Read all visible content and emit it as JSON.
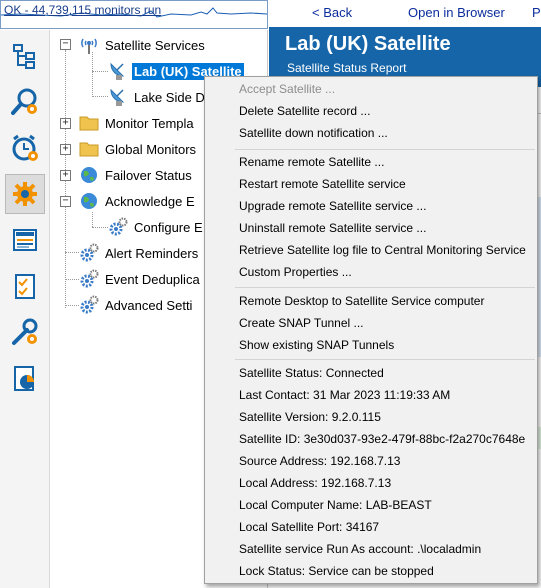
{
  "status_strip": {
    "text": "OK - 44,739,115 monitors run"
  },
  "icon_bar": {
    "items": [
      {
        "icon": "tree-structure-icon"
      },
      {
        "icon": "search-settings-icon"
      },
      {
        "icon": "alarm-clock-icon"
      },
      {
        "icon": "gear-settings-icon"
      },
      {
        "icon": "news-icon"
      },
      {
        "icon": "checklist-icon"
      },
      {
        "icon": "tools-icon"
      },
      {
        "icon": "report-chart-icon"
      }
    ]
  },
  "tree": {
    "satellite_services": "Satellite Services",
    "lab_uk": "Lab (UK) Satellite",
    "lake_side": "Lake Side D",
    "monitor_templates": "Monitor Templa",
    "global_monitors": "Global Monitors",
    "failover_status": "Failover Status",
    "acknowledge": "Acknowledge E",
    "configure": "Configure E",
    "alert_reminders": "Alert Reminders",
    "event_dedup": "Event Deduplica",
    "advanced_settings": "Advanced Setti"
  },
  "right": {
    "back_link": "< Back",
    "open_browser_link": "Open in Browser",
    "cut_link": "P",
    "title": "Lab (UK) Satellite",
    "subtitle": "Satellite Status Report"
  },
  "context_menu": {
    "accept": "Accept Satellite ...",
    "delete": "Delete Satellite record ...",
    "down_notification": "Satellite down notification ...",
    "rename": "Rename remote Satellite ...",
    "restart": "Restart remote Satellite service",
    "upgrade": "Upgrade remote Satellite service ...",
    "uninstall": "Uninstall remote Satellite service ...",
    "retrieve_log": "Retrieve Satellite log file to Central Monitoring Service",
    "custom_properties": "Custom Properties ...",
    "remote_desktop": "Remote Desktop to Satellite Service computer",
    "create_snap": "Create SNAP Tunnel ...",
    "show_snap": "Show existing SNAP Tunnels",
    "info": {
      "status": "Satellite Status: Connected",
      "last_contact": "Last Contact: 31 Mar 2023 11:19:33 AM",
      "version": "Satellite Version: 9.2.0.115",
      "id": "Satellite ID: 3e30d037-93e2-479f-88bc-f2a270c7648e",
      "source_address": "Source Address: 192.168.7.13",
      "local_address": "Local Address: 192.168.7.13",
      "computer_name": "Local Computer Name: LAB-BEAST",
      "port": "Local Satellite Port: 34167",
      "run_as": "Satellite service Run As account: .\\localadmin",
      "lock_status": "Lock Status: Service can be stopped"
    }
  }
}
